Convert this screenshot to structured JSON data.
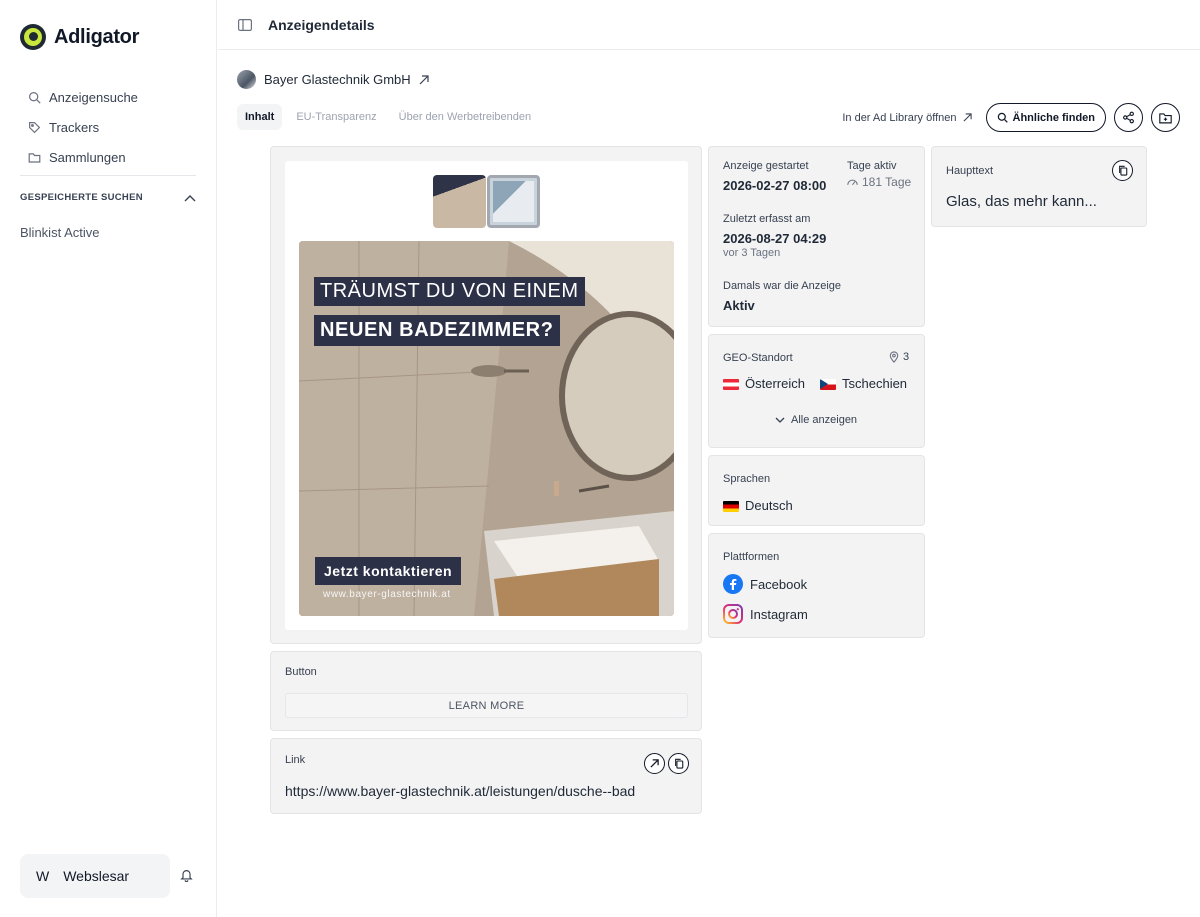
{
  "sidebar": {
    "brand": "Adligator",
    "nav": [
      {
        "label": "Anzeigensuche",
        "icon": "search-icon"
      },
      {
        "label": "Trackers",
        "icon": "tag-icon"
      },
      {
        "label": "Sammlungen",
        "icon": "folder-icon"
      }
    ],
    "saved_heading": "GESPEICHERTE SUCHEN",
    "saved_items": [
      "Blinkist Active"
    ],
    "user": {
      "initial": "W",
      "name": "Webslesar"
    }
  },
  "header": {
    "title": "Anzeigendetails"
  },
  "advertiser": {
    "name": "Bayer Glastechnik GmbH"
  },
  "tabs": [
    {
      "label": "Inhalt",
      "active": true
    },
    {
      "label": "EU-Transparenz",
      "active": false
    },
    {
      "label": "Über den Werbetreibenden",
      "active": false
    }
  ],
  "actions": {
    "library_link": "In der Ad Library öffnen",
    "similar": "Ähnliche finden"
  },
  "ad_creative": {
    "headline_1": "TRÄUMST DU VON EINEM",
    "headline_2": "NEUEN BADEZIMMER?",
    "cta": "Jetzt kontaktieren",
    "url": "www.bayer-glastechnik.at"
  },
  "button_card": {
    "label": "Button",
    "value": "LEARN MORE"
  },
  "link_card": {
    "label": "Link",
    "url": "https://www.bayer-glastechnik.at/leistungen/dusche--bad"
  },
  "info": {
    "started_label": "Anzeige gestartet",
    "started_value": "2026-02-27 08:00",
    "active_days_label": "Tage aktiv",
    "active_days_value": "181 Tage",
    "last_seen_label": "Zuletzt erfasst am",
    "last_seen_value": "2026-08-27 04:29",
    "last_seen_ago": "vor 3 Tagen",
    "status_label": "Damals war die Anzeige",
    "status_value": "Aktiv"
  },
  "geo": {
    "label": "GEO-Standort",
    "count": "3",
    "countries": [
      "Österreich",
      "Tschechien"
    ],
    "show_all": "Alle anzeigen"
  },
  "languages": {
    "label": "Sprachen",
    "items": [
      "Deutsch"
    ]
  },
  "platforms": {
    "label": "Plattformen",
    "items": [
      "Facebook",
      "Instagram"
    ]
  },
  "main_text": {
    "label": "Haupttext",
    "value": "Glas, das mehr kann..."
  },
  "colors": {
    "accent": "#c8e63c",
    "ad_label_bg": "#2d3148",
    "card_bg": "#f3f3f3"
  }
}
